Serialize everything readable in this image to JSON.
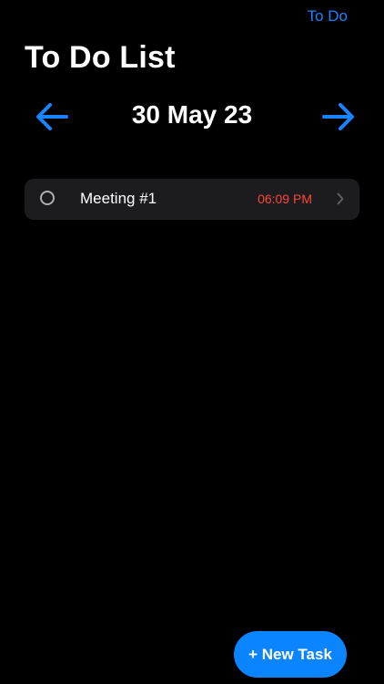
{
  "nav": {
    "link_label": "To Do"
  },
  "header": {
    "title": "To Do List"
  },
  "date_nav": {
    "date": "30 May 23",
    "prev_icon": "arrow-left-icon",
    "next_icon": "arrow-right-icon"
  },
  "tasks": [
    {
      "title": "Meeting #1",
      "time": "06:09 PM",
      "completed": false
    }
  ],
  "actions": {
    "new_task_label": "+ New Task"
  },
  "colors": {
    "background": "#000000",
    "accent": "#0a84ff",
    "card": "#1c1c1e",
    "time": "#ff453a",
    "text": "#ffffff"
  }
}
